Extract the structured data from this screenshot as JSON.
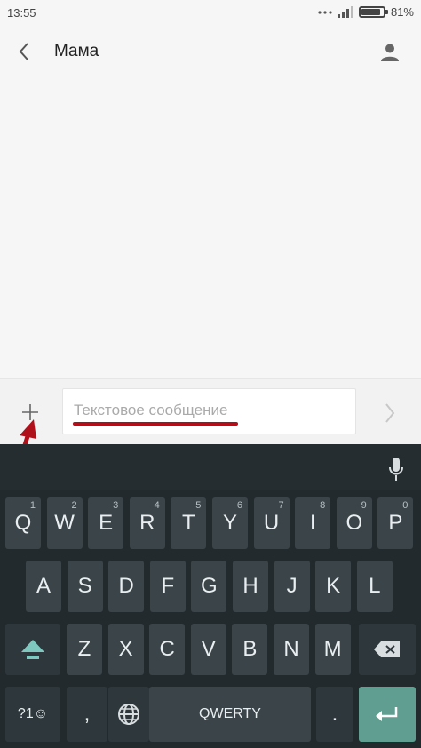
{
  "status_bar": {
    "time": "13:55",
    "battery_percent": "81%",
    "battery_level": 0.81
  },
  "header": {
    "contact_name": "Мама"
  },
  "compose": {
    "placeholder": "Текстовое сообщение",
    "value": ""
  },
  "keyboard": {
    "row1": [
      {
        "label": "Q",
        "hint": "1"
      },
      {
        "label": "W",
        "hint": "2"
      },
      {
        "label": "E",
        "hint": "3"
      },
      {
        "label": "R",
        "hint": "4"
      },
      {
        "label": "T",
        "hint": "5"
      },
      {
        "label": "Y",
        "hint": "6"
      },
      {
        "label": "U",
        "hint": "7"
      },
      {
        "label": "I",
        "hint": "8"
      },
      {
        "label": "O",
        "hint": "9"
      },
      {
        "label": "P",
        "hint": "0"
      }
    ],
    "row2": [
      "A",
      "S",
      "D",
      "F",
      "G",
      "H",
      "J",
      "K",
      "L"
    ],
    "row3": [
      "Z",
      "X",
      "C",
      "V",
      "B",
      "N",
      "M"
    ],
    "symbols_label": "?1☺",
    "comma": ",",
    "space_label": "QWERTY",
    "period": "."
  },
  "colors": {
    "accent_underline": "#b0101a",
    "enter_key": "#5f9e91",
    "keyboard_bg": "#232a2e"
  },
  "icons": {
    "back": "chevron-left-icon",
    "contact": "person-icon",
    "attach": "plus-icon",
    "send": "chevron-right-icon",
    "mic": "microphone-icon",
    "shift": "shift-arrow-icon",
    "backspace": "backspace-icon",
    "globe": "globe-icon",
    "enter": "enter-icon"
  }
}
